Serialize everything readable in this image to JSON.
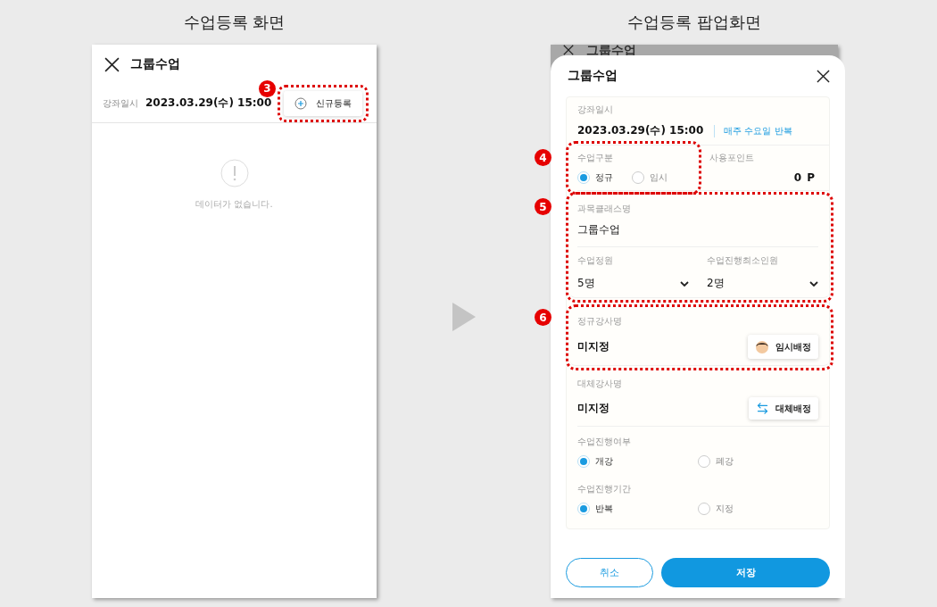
{
  "left_screen": {
    "caption": "수업등록 화면",
    "title": "그룹수업",
    "date_label": "강좌일시",
    "date_value": "2023.03.29(수) 15:00",
    "new_button": {
      "label": "신규등록",
      "callout": "3"
    },
    "empty_message": "데이터가 없습니다."
  },
  "right_screen": {
    "caption": "수업등록 팝업화면",
    "background_title": "그룹수업",
    "popup": {
      "title": "그룹수업",
      "date_label": "강좌일시",
      "date_value": "2023.03.29(수) 15:00",
      "repeat_text": "매주 수요일 반복",
      "class_type": {
        "label": "수업구분",
        "callout": "4",
        "options": [
          {
            "label": "정규",
            "selected": true
          },
          {
            "label": "임시",
            "selected": false
          }
        ]
      },
      "points": {
        "label": "사용포인트",
        "value": "0",
        "unit": "P"
      },
      "class_info": {
        "callout": "5",
        "name_label": "과목클래스명",
        "name_value": "그룹수업",
        "capacity_label": "수업정원",
        "capacity_value": "5명",
        "min_label": "수업진행최소인원",
        "min_value": "2명"
      },
      "regular_teacher": {
        "callout": "6",
        "label": "정규강사명",
        "value": "미지정",
        "button": "임시배정"
      },
      "substitute_teacher": {
        "label": "대체강사명",
        "value": "미지정",
        "button": "대체배정"
      },
      "radio_groups": [
        {
          "label": "수업진행여부",
          "options": [
            {
              "label": "개강",
              "selected": true
            },
            {
              "label": "폐강",
              "selected": false
            }
          ]
        },
        {
          "label": "수업진행기간",
          "options": [
            {
              "label": "반복",
              "selected": true
            },
            {
              "label": "지정",
              "selected": false
            }
          ]
        }
      ],
      "buttons": {
        "cancel": "취소",
        "save": "저장"
      }
    }
  }
}
